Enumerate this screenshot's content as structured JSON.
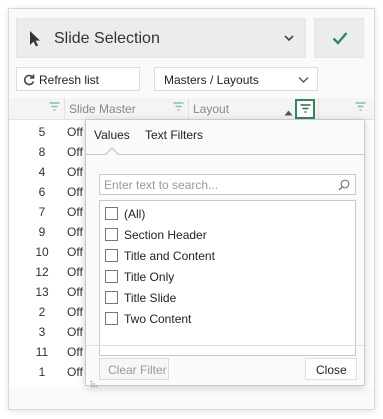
{
  "header": {
    "title": "Slide Selection",
    "confirm_color": "#2e8b57"
  },
  "toolbar": {
    "refresh_label": "Refresh list",
    "view_select": "Masters / Layouts"
  },
  "columns": {
    "slide_master": "Slide Master",
    "layout": "Layout",
    "layout_sort": "ascending",
    "layout_filter_active": true
  },
  "rows": [
    {
      "num": "5",
      "master": "Off"
    },
    {
      "num": "8",
      "master": "Off"
    },
    {
      "num": "4",
      "master": "Off"
    },
    {
      "num": "6",
      "master": "Off"
    },
    {
      "num": "7",
      "master": "Off"
    },
    {
      "num": "9",
      "master": "Off"
    },
    {
      "num": "10",
      "master": "Off"
    },
    {
      "num": "12",
      "master": "Off"
    },
    {
      "num": "13",
      "master": "Off"
    },
    {
      "num": "2",
      "master": "Off"
    },
    {
      "num": "3",
      "master": "Off"
    },
    {
      "num": "11",
      "master": "Off"
    },
    {
      "num": "1",
      "master": "Off"
    }
  ],
  "filter_popup": {
    "tabs": [
      "Values",
      "Text Filters"
    ],
    "active_tab": "Values",
    "search_placeholder": "Enter text to search...",
    "items": [
      "(All)",
      "Section Header",
      "Title and Content",
      "Title Only",
      "Title Slide",
      "Two Content"
    ],
    "clear_label": "Clear Filter",
    "close_label": "Close"
  }
}
